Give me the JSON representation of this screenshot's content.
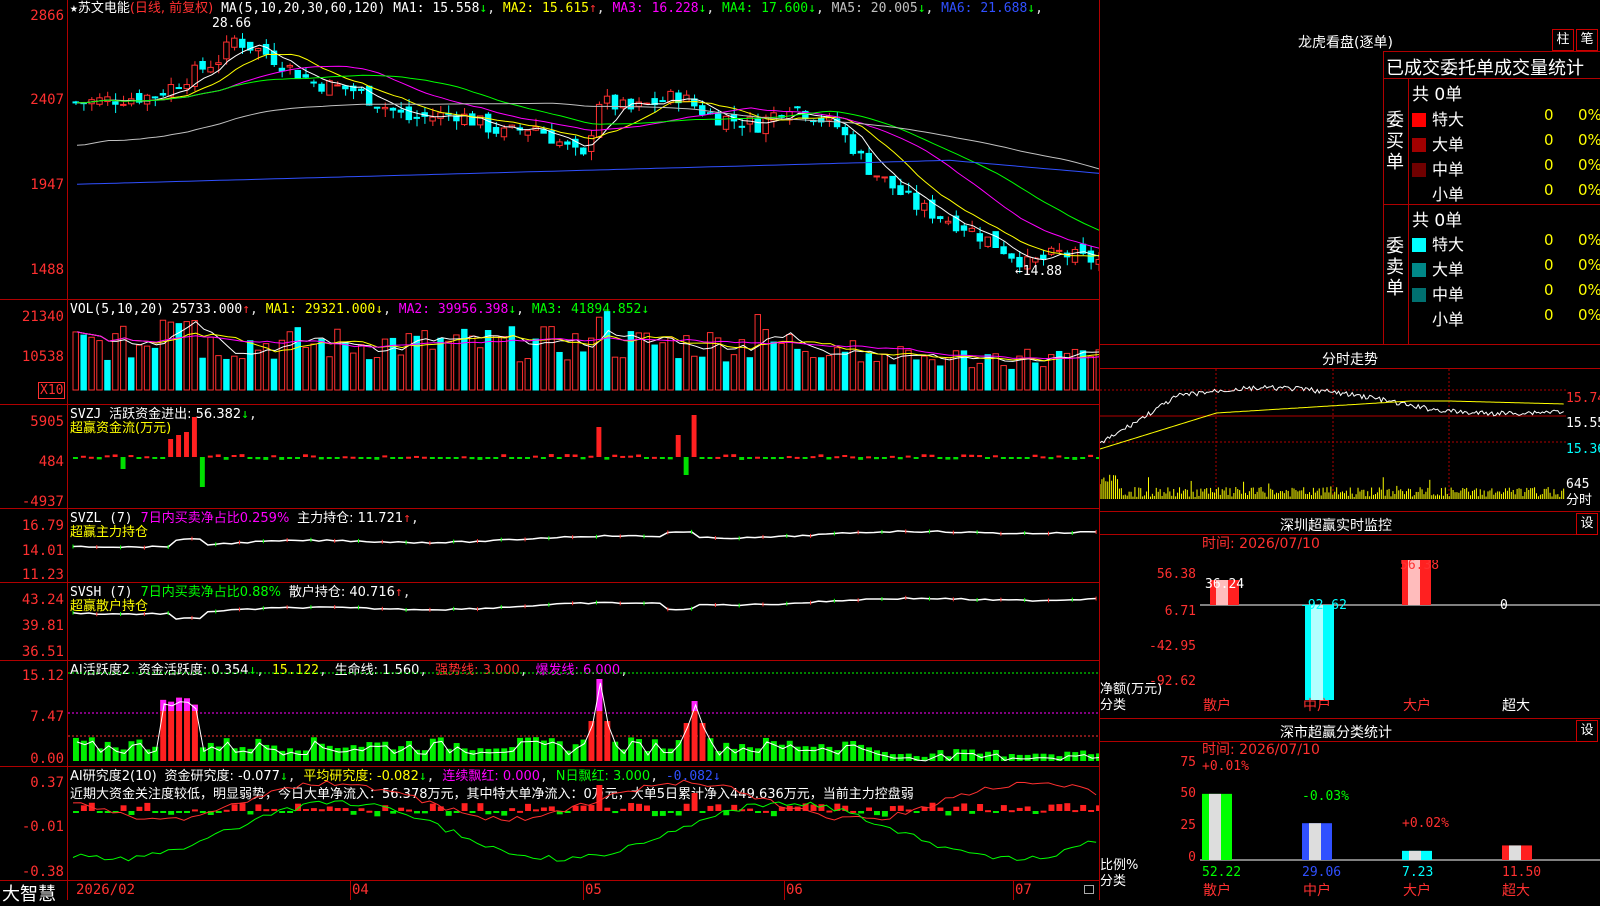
{
  "stock": {
    "star": "★",
    "name": "苏文电能",
    "mode": "(日线, 前复权)"
  },
  "main_chart": {
    "ma_label": "MA(5,10,20,30,60,120)",
    "ma": [
      {
        "name": "MA1:",
        "value": "15.558",
        "arrow": "↓",
        "color": "#ffffff"
      },
      {
        "name": "MA2:",
        "value": "15.615",
        "arrow": "↑",
        "color": "#ffff00"
      },
      {
        "name": "MA3:",
        "value": "16.228",
        "arrow": "↓",
        "color": "#ff00ff"
      },
      {
        "name": "MA4:",
        "value": "17.600",
        "arrow": "↓",
        "color": "#00ff00"
      },
      {
        "name": "MA5:",
        "value": "20.005",
        "arrow": "↓",
        "color": "#c0c0c0"
      },
      {
        "name": "MA6:",
        "value": "21.688",
        "arrow": "↓",
        "color": "#3050ff"
      }
    ],
    "y_ticks": [
      "2866",
      "2407",
      "1947",
      "1488"
    ],
    "high_label": "28.66",
    "low_label": "←14.88"
  },
  "vol": {
    "label": "VOL(5,10,20)",
    "value": "25733.000",
    "ma1": "MA1: 29321.000",
    "ma2": "MA2: 39956.398",
    "ma3": "MA3: 41894.852",
    "y_ticks": [
      "21340",
      "10538"
    ],
    "unit": "X10"
  },
  "svzj": {
    "label": "SVZJ",
    "desc": "活跃资金进出: 56.382",
    "sub": "超赢资金流(万元)",
    "y_ticks": [
      "5905",
      "484",
      "-4937"
    ]
  },
  "svzl": {
    "label": "SVZL (7)",
    "desc": "7日内买卖净占比0.259%",
    "hold": "主力持仓: 11.721",
    "sub": "超赢主力持仓",
    "y_ticks": [
      "16.79",
      "14.01",
      "11.23"
    ]
  },
  "svsh": {
    "label": "SVSH (7)",
    "desc": "7日内买卖净占比0.88%",
    "hold": "散户持仓: 40.716",
    "sub": "超赢散户持仓",
    "y_ticks": [
      "43.24",
      "39.81",
      "36.51"
    ]
  },
  "ai_active": {
    "label": "AI活跃度2",
    "a": "资金活跃度: 0.354",
    "b": "15.122",
    "c": "生命线: 1.560",
    "d": "强势线: 3.000",
    "e": "爆发线: 6.000",
    "y_ticks": [
      "15.12",
      "7.47",
      "0.00"
    ]
  },
  "ai_research": {
    "label": "AI研究度2(10)",
    "a": "资金研究度: -0.077",
    "b": "平均研究度: -0.082",
    "c": "连续飘红: 0.000",
    "d": "N日飘红: 3.000",
    "e": "-0.082",
    "comment": "近期大资金关注度较低，明显弱势，今日大单净流入：56.378万元，其中特大单净流入：0万元，大单5日累计净入449.636万元，当前主力控盘弱",
    "y_ticks": [
      "0.37",
      "-0.01",
      "-0.38"
    ]
  },
  "x_axis": {
    "brand": "大智慧",
    "dates": [
      "2026/02",
      "04",
      "05",
      "06",
      "07"
    ]
  },
  "right": {
    "lhb_title": "龙虎看盘(逐单)",
    "btn_zhu": "柱",
    "btn_bi": "笔",
    "table_title": "已成交委托单成交量统计",
    "buy_side": "委买单",
    "sell_side": "委卖单",
    "buy_total": "共 0单",
    "sell_total": "共 0单",
    "buy_rows": [
      {
        "name": "特大",
        "n": "0",
        "p": "0%",
        "color": "#ff0000"
      },
      {
        "name": "大单",
        "n": "0",
        "p": "0%",
        "color": "#a00000"
      },
      {
        "name": "中单",
        "n": "0",
        "p": "0%",
        "color": "#700000"
      },
      {
        "name": "小单",
        "n": "0",
        "p": "0%",
        "color": "#000000"
      }
    ],
    "sell_rows": [
      {
        "name": "特大",
        "n": "0",
        "p": "0%",
        "color": "#00ffff"
      },
      {
        "name": "大单",
        "n": "0",
        "p": "0%",
        "color": "#008888"
      },
      {
        "name": "中单",
        "n": "0",
        "p": "0%",
        "color": "#007070"
      },
      {
        "name": "小单",
        "n": "0",
        "p": "0%",
        "color": "#000000"
      }
    ],
    "intraday_title": "分时走势",
    "intraday_prices": [
      "15.74",
      "15.55",
      "15.36"
    ],
    "intraday_vol": "645",
    "intraday_unit": "分时",
    "monitor_title": "深圳超赢实时监控",
    "monitor_btn": "设",
    "monitor_time": "时间: 2026/07/10",
    "monitor_y": [
      "56.38",
      "6.71",
      "-42.95",
      "-92.62"
    ],
    "monitor_unit": "净额(万元)",
    "monitor_cat": "分类",
    "monitor_vals": [
      "36.24",
      "-92.62",
      "56.38",
      "0"
    ],
    "categories": [
      "散户",
      "中户",
      "大户",
      "超大"
    ],
    "stat_title": "深市超赢分类统计",
    "stat_btn": "设",
    "stat_time": "时间: 2026/07/10",
    "stat_y": [
      "75",
      "50",
      "25",
      "0"
    ],
    "stat_unit": "比例%",
    "stat_cat": "分类",
    "stat_top": [
      "+0.01%",
      "-0.03%",
      "+0.02%"
    ],
    "stat_vals": [
      "52.22",
      "29.06",
      "7.23",
      "11.50"
    ]
  }
}
